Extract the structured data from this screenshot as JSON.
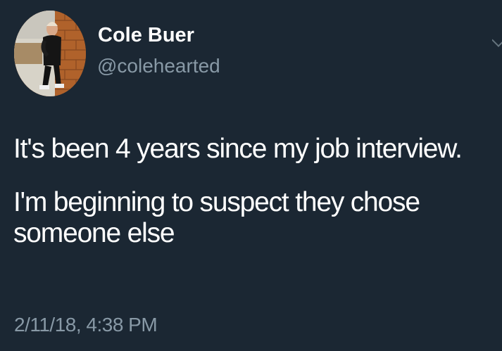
{
  "author": {
    "name": "Cole Buer",
    "handle": "@colehearted"
  },
  "tweet": {
    "line1": "It's been 4 years since my job interview.",
    "line2": "I'm beginning to suspect they chose",
    "line3": "someone else"
  },
  "timestamp": "2/11/18, 4:38 PM",
  "colors": {
    "background": "#1b2733",
    "text": "#ffffff",
    "secondary_text": "#8899a6"
  },
  "icons": {
    "menu": "chevron-down-icon"
  }
}
